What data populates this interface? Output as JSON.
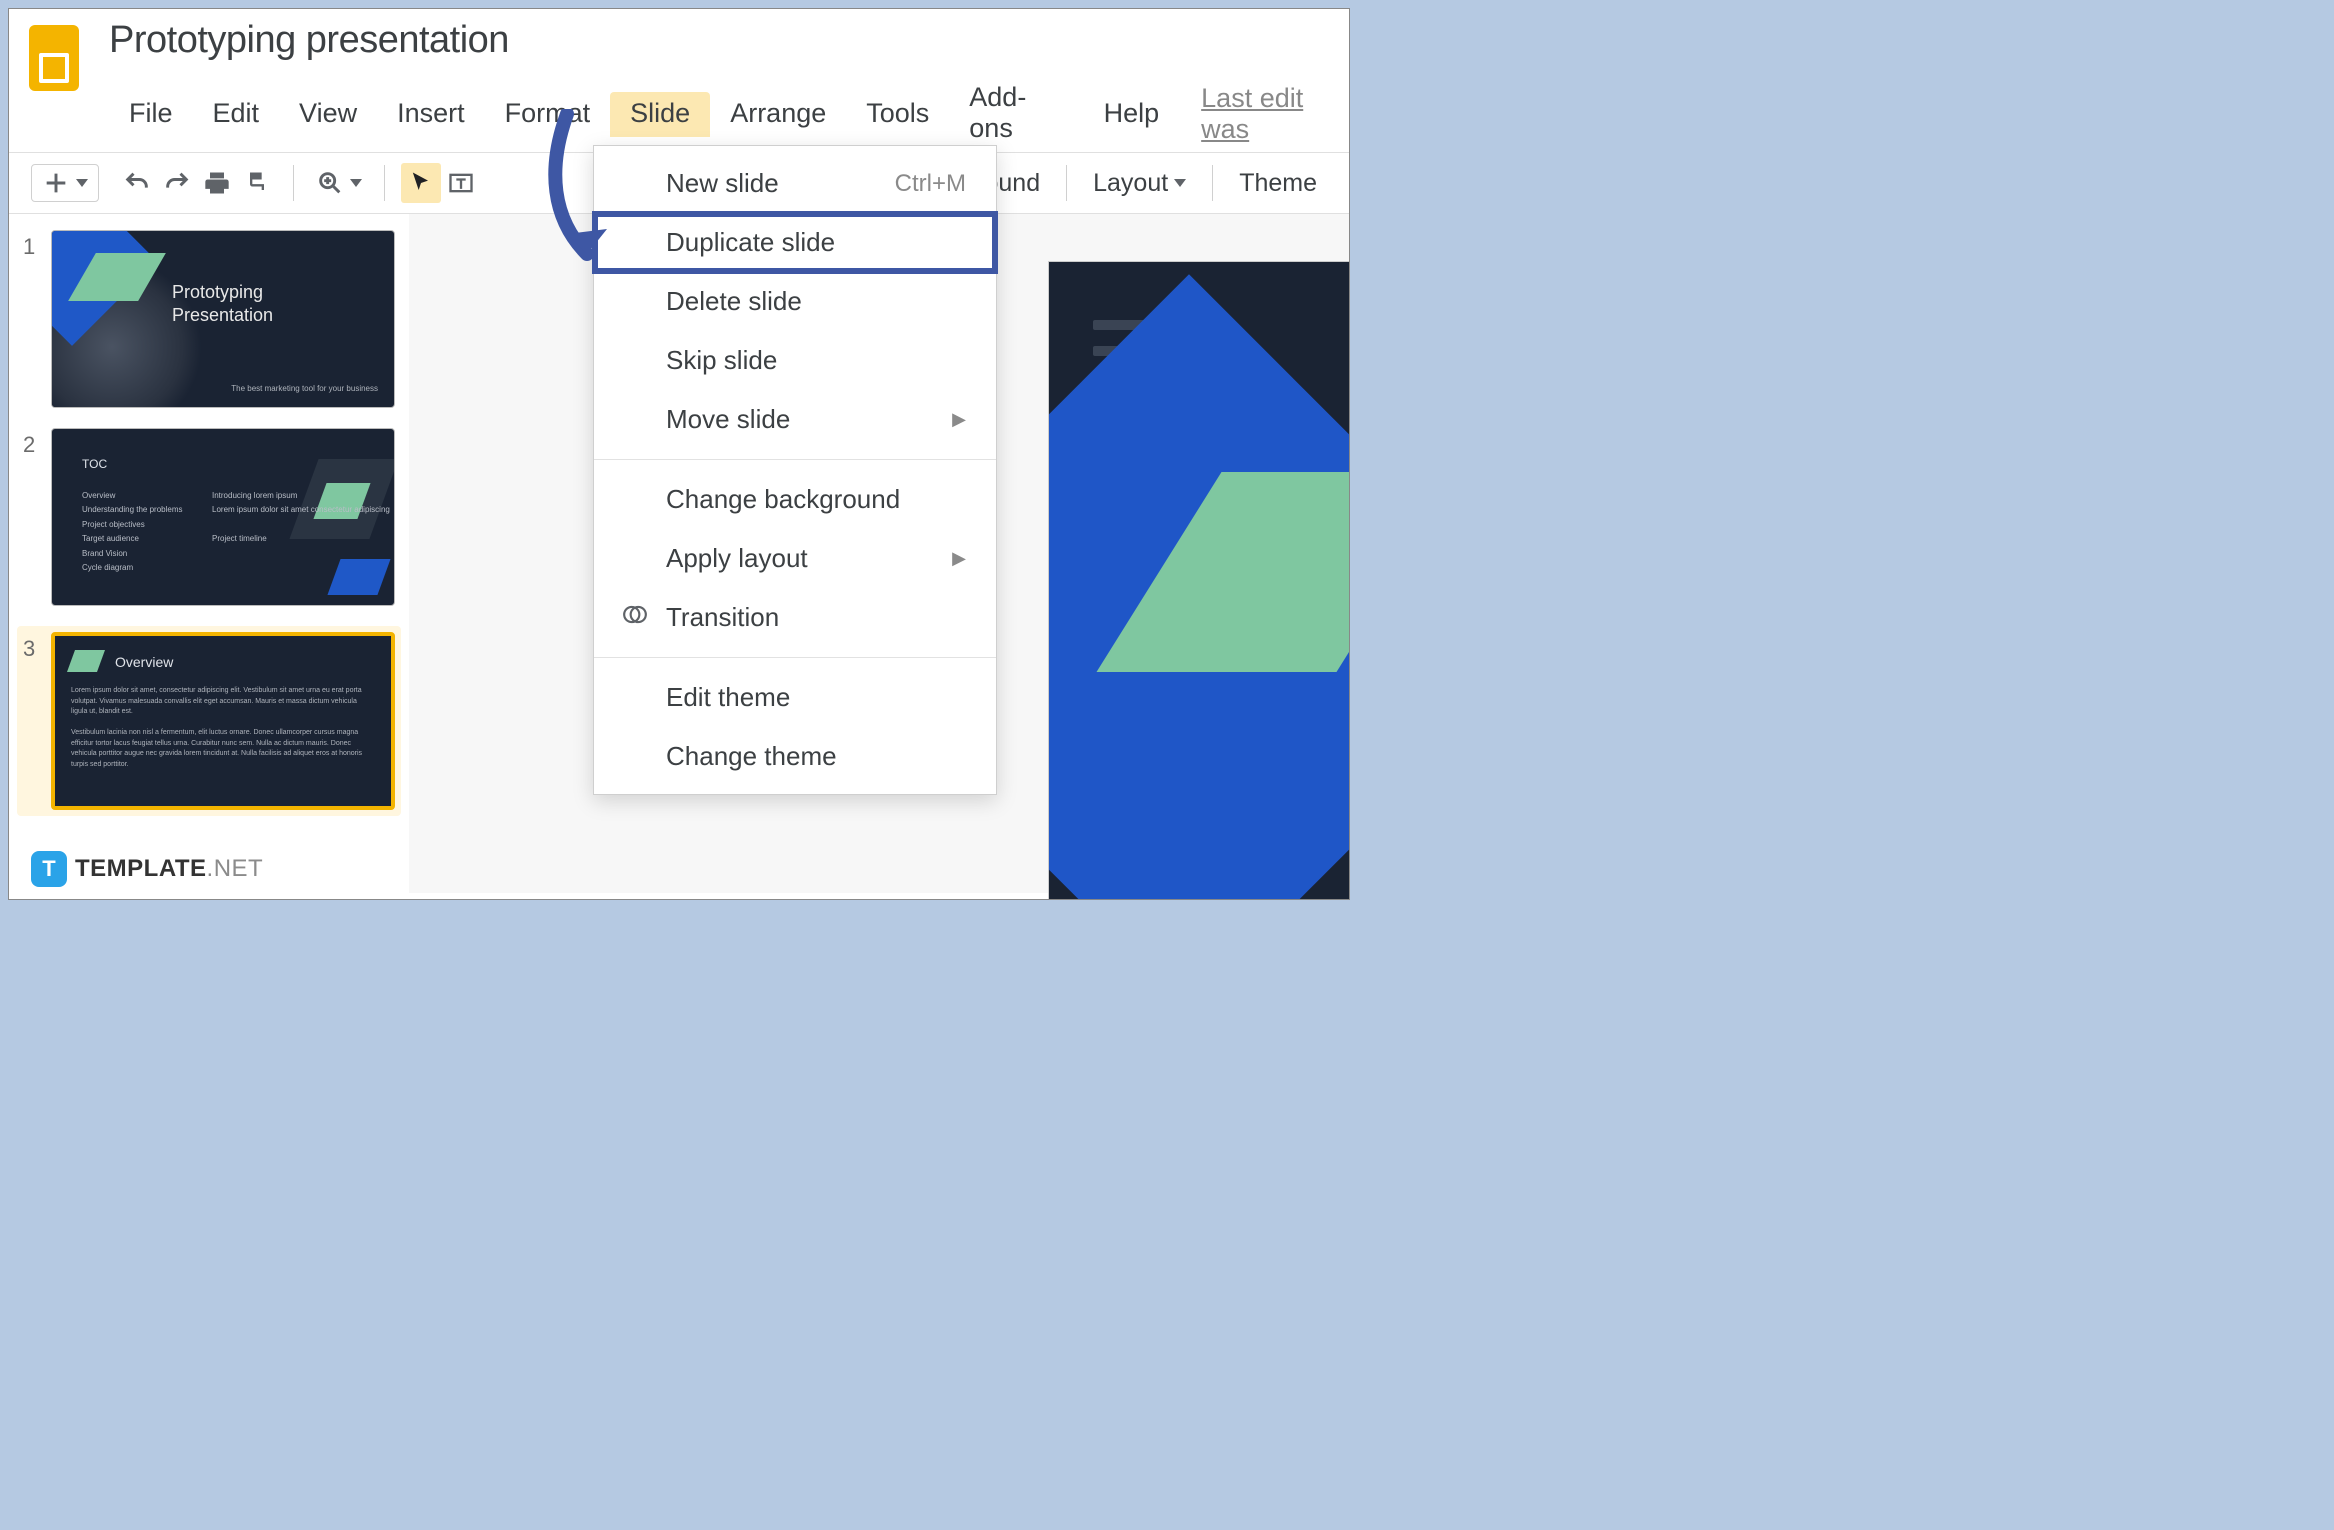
{
  "doc": {
    "title": "Prototyping presentation"
  },
  "menubar": {
    "file": "File",
    "edit": "Edit",
    "view": "View",
    "insert": "Insert",
    "format": "Format",
    "slide": "Slide",
    "arrange": "Arrange",
    "tools": "Tools",
    "addons": "Add-ons",
    "help": "Help",
    "last_edit": "Last edit was"
  },
  "toolbar": {
    "background": "ckground",
    "layout": "Layout",
    "theme": "Theme"
  },
  "dropdown": {
    "new_slide": "New slide",
    "new_slide_shortcut": "Ctrl+M",
    "duplicate": "Duplicate slide",
    "delete": "Delete slide",
    "skip": "Skip slide",
    "move": "Move slide",
    "change_bg": "Change background",
    "apply_layout": "Apply layout",
    "transition": "Transition",
    "edit_theme": "Edit theme",
    "change_theme": "Change theme"
  },
  "thumbs": {
    "n1": "1",
    "n2": "2",
    "n3": "3",
    "slide1_title_a": "Prototyping",
    "slide1_title_b": "Presentation",
    "slide1_sub": "The best marketing tool for your business",
    "slide2_title": "TOC",
    "slide2_col_l": "Overview\nUnderstanding the problems\nProject objectives\nTarget audience\nBrand Vision\nCycle diagram",
    "slide2_col_r": "Introducing lorem ipsum\nLorem ipsum dolor sit amet consectetur adipiscing\n\nProject timeline",
    "slide3_title": "Overview",
    "slide3_body": "Lorem ipsum dolor sit amet, consectetur adipiscing elit. Vestibulum sit amet urna eu erat porta volutpat. Vivamus malesuada convallis elit eget accumsan. Mauris et massa dictum vehicula ligula ut, blandit est.\n\nVestibulum lacinia non nisl a fermentum, elit luctus ornare. Donec ullamcorper cursus magna efficitur tortor lacus feugiat tellus urna. Curabitur nunc sem. Nulla ac dictum mauris. Donec vehicula porttitor augue nec gravida lorem tincidunt at. Nulla facilisis ad aliquet eros at honoris turpis sed porttitor."
  },
  "watermark": {
    "badge": "T",
    "name": "TEMPLATE",
    "suffix": ".NET"
  }
}
